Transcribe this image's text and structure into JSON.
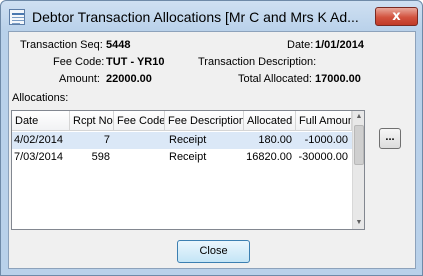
{
  "window": {
    "title": "Debtor Transaction Allocations [Mr C and Mrs K Ad...",
    "close_glyph": "x"
  },
  "fields": {
    "transaction_seq_label": "Transaction Seq:",
    "transaction_seq_value": "5448",
    "date_label": "Date:",
    "date_value": "1/01/2014",
    "fee_code_label": "Fee Code:",
    "fee_code_value": "TUT - YR10",
    "transaction_description_label": "Transaction Description:",
    "transaction_description_value": "",
    "amount_label": "Amount:",
    "amount_value": "22000.00",
    "total_allocated_label": "Total Allocated:",
    "total_allocated_value": "17000.00"
  },
  "allocations": {
    "label": "Allocations:",
    "columns": [
      "Date",
      "Rcpt No",
      "Fee Code",
      "Fee Description",
      "Allocated",
      "Full Amount"
    ],
    "rows": [
      {
        "date": "4/02/2014",
        "rcpt_no": "7",
        "fee_code": "",
        "fee_description": "Receipt",
        "allocated": "180.00",
        "full_amount": "-1000.00"
      },
      {
        "date": "7/03/2014",
        "rcpt_no": "598",
        "fee_code": "",
        "fee_description": "Receipt",
        "allocated": "16820.00",
        "full_amount": "-30000.00"
      }
    ]
  },
  "buttons": {
    "ellipsis_label": "...",
    "close_label": "Close"
  },
  "colors": {
    "window_frame": "#b9d1ea",
    "selected_row": "#dbe8f7",
    "close_button": "#d2523e"
  }
}
